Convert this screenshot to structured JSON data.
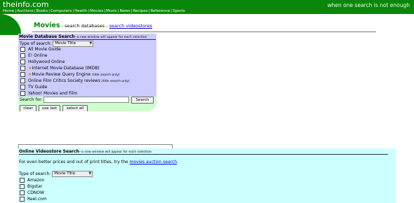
{
  "header": {
    "logo": "theinfo.com",
    "tagline": "when one search is not enough",
    "nav": [
      "Home",
      "Auctions",
      "Books",
      "Computers",
      "Health",
      "Movies",
      "Music",
      "News",
      "Recipes",
      "Reference",
      "Sports"
    ]
  },
  "section": {
    "title": "Movies",
    "subtitle": " - search databases - ",
    "link": "search videostores"
  },
  "movie_panel": {
    "heading": "Movie Database Search",
    "note": "--a new window will appear for each selection",
    "type_label": "Type of search:",
    "type_value": "Movie Title",
    "options": [
      {
        "label": "All Movie Guide",
        "star": "",
        "note": ""
      },
      {
        "label": "E! Online",
        "star": "",
        "note": ""
      },
      {
        "label": "Hollywood Online",
        "star": "",
        "note": ""
      },
      {
        "label": "Internet Movie Database (IMDB)",
        "star": "★",
        "note": ""
      },
      {
        "label": "Movie Review Query Engine",
        "star": "★",
        "note": "(title search only)"
      },
      {
        "label": "Online Film Critics Society reviews",
        "star": "",
        "note": "(title search only)"
      },
      {
        "label": "TV Guide",
        "star": "",
        "note": ""
      },
      {
        "label": "Yahoo! Movies and Film",
        "star": "",
        "note": ""
      }
    ],
    "search_label": "Search for:",
    "search_value": "",
    "search_button": "Search",
    "clear_button": "clear",
    "use_last_button": "use last",
    "select_all_button": "select all"
  },
  "video_panel": {
    "heading": "Online Videostore Search",
    "note": "--a new window will appear for each selection",
    "text_before": "For even better prices and out of print titles, try the ",
    "text_link": "movies auction search",
    "text_after": ".",
    "type_label": "Type of search:",
    "type_value": "Movie Title",
    "options": [
      "Amazon",
      "Bigstar",
      "CDNOW",
      "Reel.com"
    ]
  },
  "colors": {
    "brand_green": "#0a870a",
    "movie_panel_bg": "#ccccff",
    "search_area_bg": "#ccffcc",
    "video_panel_bg": "#ccffff",
    "link": "#0000cc",
    "star": "#e08000"
  }
}
